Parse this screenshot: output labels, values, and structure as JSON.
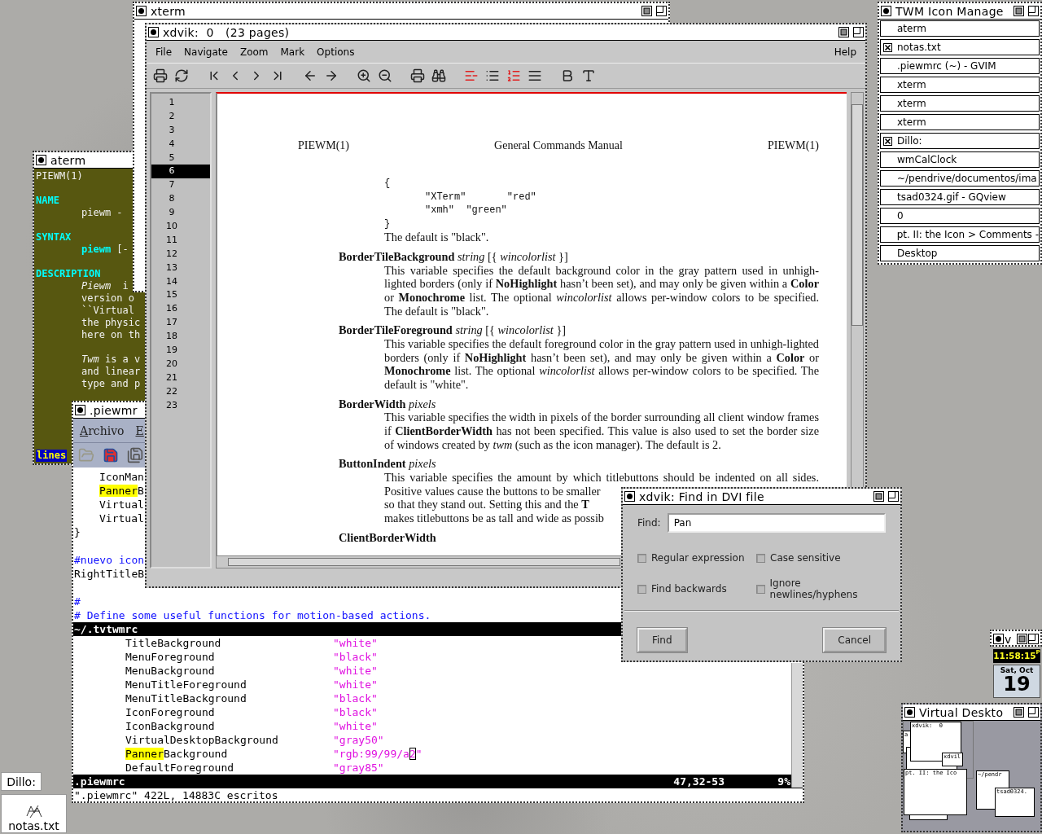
{
  "xterm": {
    "title": "xterm"
  },
  "aterm": {
    "title": "aterm",
    "lines": [
      {
        "kind": "plain",
        "text": "PIEWM(1)"
      },
      {
        "kind": "blank"
      },
      {
        "kind": "heading",
        "text": "NAME"
      },
      {
        "kind": "indented",
        "text": "piewm -"
      },
      {
        "kind": "blank"
      },
      {
        "kind": "heading",
        "text": "SYNTAX"
      },
      {
        "kind": "indented",
        "text": "**piewm** [-"
      },
      {
        "kind": "blank"
      },
      {
        "kind": "heading",
        "text": "DESCRIPTION"
      },
      {
        "kind": "indented",
        "text": "*Piewm*  i"
      },
      {
        "kind": "indented",
        "text": "version o"
      },
      {
        "kind": "indented",
        "text": "``Virtual"
      },
      {
        "kind": "indented",
        "text": "the physic"
      },
      {
        "kind": "indented",
        "text": "here on th"
      },
      {
        "kind": "blank"
      },
      {
        "kind": "indented",
        "text": "*Twm* is a v"
      },
      {
        "kind": "indented",
        "text": "and linear"
      },
      {
        "kind": "indented",
        "text": "type and p"
      }
    ],
    "status": "lines"
  },
  "gvim": {
    "title": ".piewmr",
    "menus": [
      "Archivo",
      "E"
    ],
    "top_lines": [
      {
        "kind": "code",
        "indent": true,
        "parts": [
          {
            "text": "IconMan"
          }
        ]
      },
      {
        "kind": "code",
        "indent": true,
        "parts": [
          {
            "text": "Panner",
            "match": true
          },
          {
            "text": "B"
          }
        ]
      },
      {
        "kind": "code",
        "indent": true,
        "parts": [
          {
            "text": "Virtual"
          }
        ]
      },
      {
        "kind": "code",
        "indent": true,
        "parts": [
          {
            "text": "Virtual"
          }
        ]
      },
      {
        "kind": "code",
        "indent": false,
        "parts": [
          {
            "text": "}"
          }
        ]
      },
      {
        "kind": "blank"
      },
      {
        "kind": "comment",
        "indent": false,
        "parts": [
          {
            "text": "#nuevo icon"
          }
        ]
      },
      {
        "kind": "code",
        "indent": false,
        "parts": [
          {
            "text": "RightTitleB"
          }
        ]
      },
      {
        "kind": "blank"
      },
      {
        "kind": "comment",
        "indent": false,
        "parts": [
          {
            "text": "#"
          }
        ]
      },
      {
        "kind": "comment",
        "indent": false,
        "parts": [
          {
            "text": "# Define some useful functions for motion-based actions."
          }
        ]
      }
    ],
    "top_status": "~/.tvtwmrc",
    "settings": [
      {
        "key": [
          {
            "text": "TitleBackground"
          }
        ],
        "value": [
          {
            "text": "\"white\""
          }
        ]
      },
      {
        "key": [
          {
            "text": "MenuForeground"
          }
        ],
        "value": [
          {
            "text": "\"black\""
          }
        ]
      },
      {
        "key": [
          {
            "text": "MenuBackground"
          }
        ],
        "value": [
          {
            "text": "\"white\""
          }
        ]
      },
      {
        "key": [
          {
            "text": "MenuTitleForeground"
          }
        ],
        "value": [
          {
            "text": "\"white\""
          }
        ]
      },
      {
        "key": [
          {
            "text": "MenuTitleBackground"
          }
        ],
        "value": [
          {
            "text": "\"black\""
          }
        ]
      },
      {
        "key": [
          {
            "text": "IconForeground"
          }
        ],
        "value": [
          {
            "text": "\"black\""
          }
        ]
      },
      {
        "key": [
          {
            "text": "IconBackground"
          }
        ],
        "value": [
          {
            "text": "\"white\""
          }
        ]
      },
      {
        "key": [
          {
            "text": "VirtualDesktopBackground"
          }
        ],
        "value": [
          {
            "text": "\"gray50\""
          }
        ]
      },
      {
        "key": [
          {
            "text": "Panner",
            "match": true
          },
          {
            "text": "Background"
          }
        ],
        "value": [
          {
            "text": "\"rgb:99/99/a"
          },
          {
            "text": "2",
            "cursor": true
          },
          {
            "text": "\""
          }
        ]
      },
      {
        "key": [
          {
            "text": "DefaultForeground"
          }
        ],
        "value": [
          {
            "text": "\"gray85\""
          }
        ]
      }
    ],
    "status": {
      "file": ".piewmrc",
      "position": "47,32-53",
      "scroll": "9%"
    },
    "message": "\".piewmrc\" 422L, 14883C escritos"
  },
  "xdvik": {
    "title": "xdvik:  0   (23 pages)",
    "menus": [
      "File",
      "Navigate",
      "Zoom",
      "Mark",
      "Options"
    ],
    "help": "Help",
    "pages": [
      {
        "label": "1",
        "selected": false
      },
      {
        "label": "2",
        "selected": false
      },
      {
        "label": "3",
        "selected": false
      },
      {
        "label": "4",
        "selected": false
      },
      {
        "label": "5",
        "selected": false
      },
      {
        "label": "6",
        "selected": true
      },
      {
        "label": "7",
        "selected": false
      },
      {
        "label": "8",
        "selected": false
      },
      {
        "label": "9",
        "selected": false
      },
      {
        "label": "10",
        "selected": false
      },
      {
        "label": "11",
        "selected": false
      },
      {
        "label": "12",
        "selected": false
      },
      {
        "label": "13",
        "selected": false
      },
      {
        "label": "14",
        "selected": false
      },
      {
        "label": "15",
        "selected": false
      },
      {
        "label": "16",
        "selected": false
      },
      {
        "label": "17",
        "selected": false
      },
      {
        "label": "18",
        "selected": false
      },
      {
        "label": "19",
        "selected": false
      },
      {
        "label": "20",
        "selected": false
      },
      {
        "label": "21",
        "selected": false
      },
      {
        "label": "22",
        "selected": false
      },
      {
        "label": "23",
        "selected": false
      }
    ],
    "page": {
      "header": [
        "PIEWM(1)",
        "General Commands Manual",
        "PIEWM(1)"
      ],
      "code_lines": [
        {
          "indent": false,
          "text": "{"
        },
        {
          "indent": true,
          "text": "\"XTerm\"       \"red\""
        },
        {
          "indent": true,
          "text": "\"xmh\"  \"green\""
        },
        {
          "indent": false,
          "text": "}"
        }
      ],
      "code_note": "The default is \"black\".",
      "entries": [
        {
          "kind": "paragraph",
          "term": "BorderTileBackground",
          "args": "*string* [{ *wincolorlist* }]",
          "body": "This variable specifies the default background color in the gray pattern used in unhigh-lighted borders (only if **NoHighlight** hasn’t been set), and may only be given within a **Color** or **Monochrome** list.  The optional *wincolorlist* allows per-window colors to be specified.  The default  is \"black\"."
        },
        {
          "kind": "paragraph",
          "term": "BorderTileForeground",
          "args": "*string* [{ *wincolorlist* }]",
          "body": "This variable specifies the default foreground color in the gray pattern used in unhigh-lighted borders (only if **NoHighlight** hasn’t been set), and may only be given within a **Color** or **Monochrome** list.  The optional *wincolorlist* allows per-window colors to be specified.  The default is \"white\"."
        },
        {
          "kind": "paragraph",
          "term": "BorderWidth",
          "args": "*pixels*",
          "body": "This variable specifies the width in pixels of the border surrounding all client window frames if **ClientBorderWidth** has not been specified.  This value is also used to set the border size of windows created by *twm* (such as the icon manager).  The default is 2."
        },
        {
          "kind": "lines",
          "term": "ButtonIndent",
          "args": "*pixels*",
          "lines": [
            "This variable specifies the amount by which titlebuttons should be indented on all sides.",
            "Positive values cause the buttons to be smaller",
            "so that they stand out.  Setting this and the **T**",
            "makes titlebuttons be as tall and wide as possib"
          ]
        },
        {
          "kind": "term",
          "term": "ClientBorderWidth"
        }
      ]
    }
  },
  "find_dialog": {
    "title": "xdvik: Find in DVI file",
    "label": "Find:",
    "value": "Pan",
    "options": [
      {
        "label": "Regular expression",
        "checked": false
      },
      {
        "label": "Case sensitive",
        "checked": false
      },
      {
        "label": "Find backwards",
        "checked": false
      },
      {
        "label": "Ignore newlines/hyphens",
        "checked": false
      }
    ],
    "buttons": [
      "Find",
      "Cancel"
    ]
  },
  "icon_manager": {
    "title": "TWM Icon Manage",
    "items": [
      {
        "label": "aterm",
        "iconified": false
      },
      {
        "label": "notas.txt",
        "iconified": true
      },
      {
        "label": ".piewmrc (~) - GVIM",
        "iconified": false
      },
      {
        "label": "xterm",
        "iconified": false
      },
      {
        "label": "xterm",
        "iconified": false
      },
      {
        "label": "xterm",
        "iconified": false
      },
      {
        "label": "Dillo:",
        "iconified": true
      },
      {
        "label": "wmCalClock",
        "iconified": false
      },
      {
        "label": "~/pendrive/documentos/ima",
        "iconified": false
      },
      {
        "label": "tsad0324.gif - GQview",
        "iconified": false
      },
      {
        "label": "0",
        "iconified": false
      },
      {
        "label": "pt. II: the Icon > Comments -",
        "iconified": false
      },
      {
        "label": "Desktop",
        "iconified": false
      }
    ]
  },
  "small_window": {
    "title": "v"
  },
  "clock": {
    "time": "11:58:15",
    "period": "P",
    "date": "Sat, Oct",
    "day": "19"
  },
  "virtual_desktop": {
    "title": "Virtual Deskto",
    "windows": [
      {
        "label": "a"
      },
      {
        "label": "xdvik:  0"
      },
      {
        "label": "xdvil"
      },
      {
        "label": "pt. II: the Ico"
      },
      {
        "label": "~/pendr"
      },
      {
        "label": "tsad0324."
      }
    ]
  },
  "desktop_icons": [
    {
      "kind": "label",
      "label": "Dillo:"
    },
    {
      "kind": "file",
      "label": "notas.txt"
    }
  ]
}
